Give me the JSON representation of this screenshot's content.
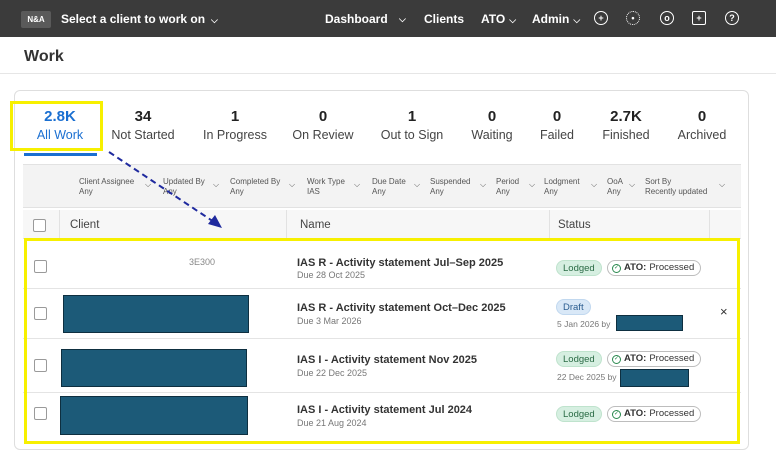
{
  "topbar": {
    "logo": "N&A",
    "client_select": "Select a client to work on",
    "nav": [
      {
        "label": "Dashboard"
      },
      {
        "label": "Clients"
      },
      {
        "label": "ATO"
      },
      {
        "label": "Admin"
      }
    ],
    "icons": [
      "plus-circle-icon",
      "gear-icon",
      "user-circle-icon",
      "gift-icon",
      "help-circle-icon"
    ]
  },
  "page": {
    "title": "Work"
  },
  "stats": [
    {
      "num": "2.8K",
      "label": "All Work",
      "active": true
    },
    {
      "num": "34",
      "label": "Not Started"
    },
    {
      "num": "1",
      "label": "In Progress"
    },
    {
      "num": "0",
      "label": "On Review"
    },
    {
      "num": "1",
      "label": "Out to Sign"
    },
    {
      "num": "0",
      "label": "Waiting"
    },
    {
      "num": "0",
      "label": "Failed"
    },
    {
      "num": "2.7K",
      "label": "Finished"
    },
    {
      "num": "0",
      "label": "Archived"
    }
  ],
  "filters": [
    {
      "label": "Client Assignee",
      "value": "Any"
    },
    {
      "label": "Updated By",
      "value": "Any"
    },
    {
      "label": "Completed By",
      "value": "Any"
    },
    {
      "label": "Work Type",
      "value": "IAS"
    },
    {
      "label": "Due Date",
      "value": "Any"
    },
    {
      "label": "Suspended",
      "value": "Any"
    },
    {
      "label": "Period",
      "value": "Any"
    },
    {
      "label": "Lodgment",
      "value": "Any"
    },
    {
      "label": "OoA",
      "value": "Any"
    },
    {
      "label": "Sort By",
      "value": "Recently updated"
    }
  ],
  "table": {
    "headers": {
      "client": "Client",
      "name": "Name",
      "status": "Status"
    },
    "rows": [
      {
        "client_partial": "3E300",
        "title": "IAS R - Activity statement Jul–Sep 2025",
        "due": "Due 28 Oct 2025",
        "status": "Lodged",
        "ato_label": "ATO:",
        "ato_value": "Processed",
        "status_sub": ""
      },
      {
        "title": "IAS R - Activity statement Oct–Dec 2025",
        "due": "Due 3 Mar 2026",
        "status": "Draft",
        "status_sub": "5 Jan 2026 by"
      },
      {
        "title": "IAS I - Activity statement Nov 2025",
        "due": "Due 22 Dec 2025",
        "status": "Lodged",
        "ato_label": "ATO:",
        "ato_value": "Processed",
        "status_sub": "22 Dec 2025 by"
      },
      {
        "title": "IAS I - Activity statement Jul 2024",
        "due": "Due 21 Aug 2024",
        "status": "Lodged",
        "ato_label": "ATO:",
        "ato_value": "Processed",
        "status_sub": ""
      }
    ]
  },
  "colors": {
    "accent": "#1a6fd1",
    "highlight": "#f7f000",
    "redaction": "#1c5a78",
    "lodged_bg": "#d6efe1",
    "draft_bg": "#d9e8f7",
    "arrow": "#1f2a9e"
  },
  "close_symbol": "×"
}
